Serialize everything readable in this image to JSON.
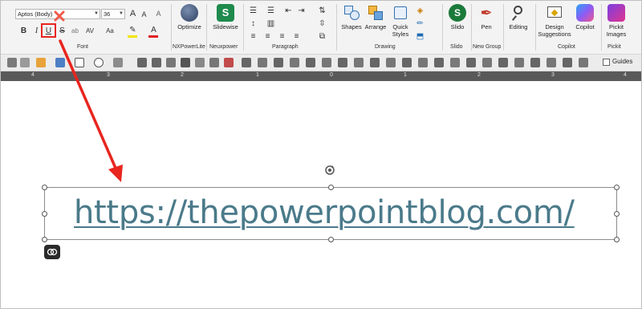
{
  "font_group": {
    "font_name": "Aptos (Body)",
    "font_size": "36",
    "label": "Font",
    "bold": "B",
    "italic": "I",
    "underline": "U",
    "strike": "S",
    "spacing": "AV",
    "case": "Aa",
    "font_color": "A",
    "grow": "A",
    "shrink": "A"
  },
  "nxpower": {
    "button_label": "Optimize",
    "group_label": "NXPowerLite"
  },
  "neuxpower": {
    "button_label": "Slidewise",
    "group_label": "Neuxpower"
  },
  "paragraph": {
    "label": "Paragraph"
  },
  "drawing": {
    "shapes_label": "Shapes",
    "arrange_label": "Arrange",
    "quick_styles_label": "Quick Styles",
    "group_label": "Drawing"
  },
  "slido": {
    "button_label": "Slido",
    "group_label": "Slido"
  },
  "new_group": {
    "button_label": "Pen",
    "group_label": "New Group"
  },
  "editing": {
    "button_label": "Editing"
  },
  "copilot_group": {
    "design_label": "Design Suggestions",
    "copilot_label": "Copilot",
    "group_label": "Copilot"
  },
  "pickit": {
    "button_label": "Pickit Images",
    "group_label": "Pickit"
  },
  "guides": {
    "label": "Guides"
  },
  "ruler": {
    "marks": [
      "4",
      "3",
      "2",
      "1",
      "0",
      "1",
      "2",
      "3",
      "4"
    ]
  },
  "slide": {
    "text": "https://thepowerpointblog.com/"
  },
  "colors": {
    "accent_red": "#e8251f",
    "link_color": "#4a7a8a",
    "slidewise_green": "#1e8a4c",
    "slido_green": "#1b7a3a"
  },
  "icons": [
    "x-mark-icon",
    "arrow-icon",
    "rotate-handle-icon",
    "copilot-icon"
  ]
}
